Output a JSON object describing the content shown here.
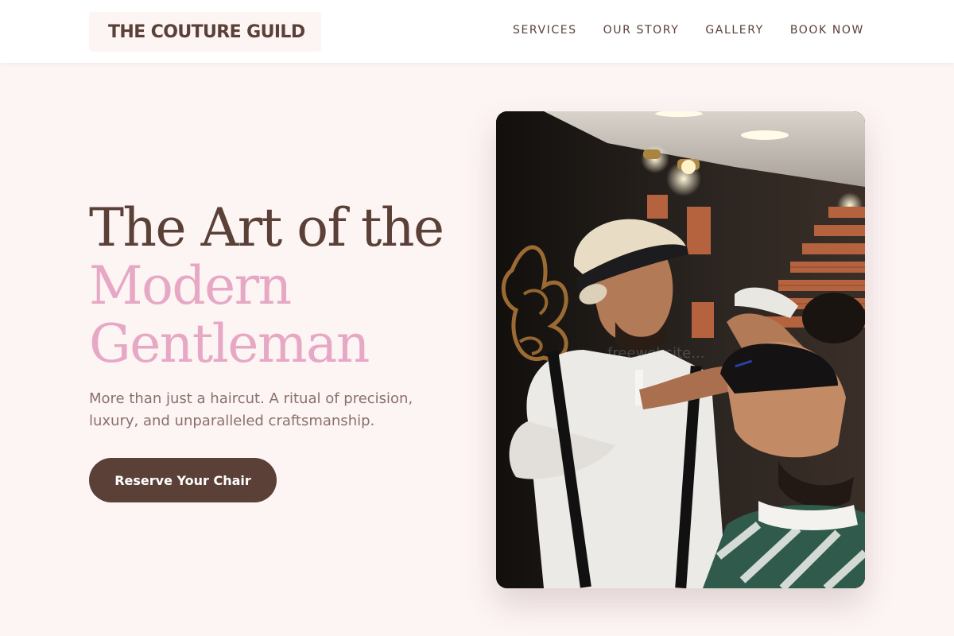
{
  "brand": {
    "name": "THE COUTURE GUILD"
  },
  "nav": {
    "items": [
      {
        "label": "SERVICES"
      },
      {
        "label": "OUR STORY"
      },
      {
        "label": "GALLERY"
      },
      {
        "label": "BOOK NOW"
      }
    ]
  },
  "hero": {
    "headline_line1": "The Art of the",
    "headline_line2": "Modern",
    "headline_line3": "Gentleman",
    "tagline": "More than just a haircut. A ritual of precision, luxury, and unparalleled craftsmanship.",
    "cta_label": "Reserve Your Chair",
    "image_watermark": "freewebsite..."
  },
  "colors": {
    "accent": "#5a4037",
    "highlight": "#e6a8c4",
    "background": "#fdf4f4",
    "body_text": "#8a716a"
  },
  "icons": {
    "hero_image": "barber-cutting-hair-photo"
  }
}
